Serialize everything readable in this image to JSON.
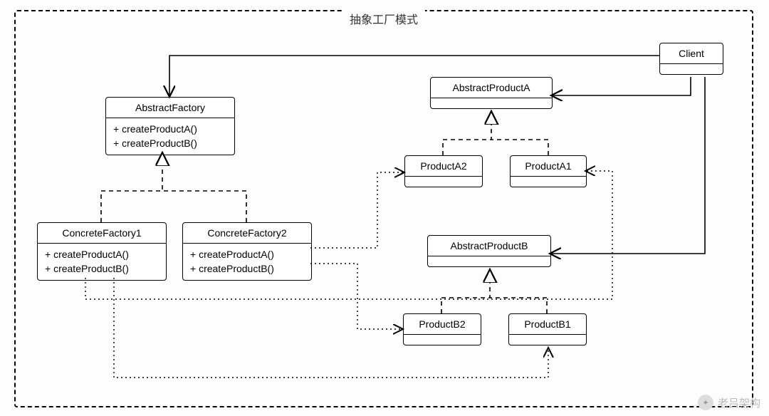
{
  "diagram": {
    "title": "抽象工厂模式",
    "client": {
      "name": "Client"
    },
    "abstractFactory": {
      "name": "AbstractFactory",
      "ops": [
        "+ createProductA()",
        "+ createProductB()"
      ]
    },
    "concreteFactory1": {
      "name": "ConcreteFactory1",
      "ops": [
        "+ createProductA()",
        "+ createProductB()"
      ]
    },
    "concreteFactory2": {
      "name": "ConcreteFactory2",
      "ops": [
        "+ createProductA()",
        "+ createProductB()"
      ]
    },
    "abstractProductA": {
      "name": "AbstractProductA"
    },
    "productA1": {
      "name": "ProductA1"
    },
    "productA2": {
      "name": "ProductA2"
    },
    "abstractProductB": {
      "name": "AbstractProductB"
    },
    "productB1": {
      "name": "ProductB1"
    },
    "productB2": {
      "name": "ProductB2"
    }
  },
  "watermark": {
    "text": "老吕架构",
    "icon": "wx"
  }
}
